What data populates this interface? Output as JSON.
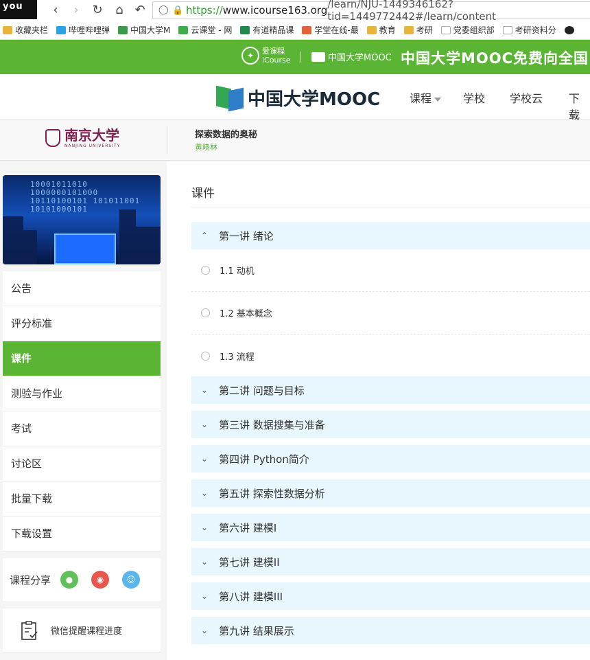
{
  "browser": {
    "tab_thumb_text": "you",
    "url_scheme": "https://",
    "url_host": "www.icourse163.org",
    "url_path": "/learn/NJU-1449346162?tid=1449772442#/learn/content",
    "bookmarks": [
      "收藏夹栏",
      "哔哩哔哩弹",
      "中国大学M",
      "云课堂 - 网",
      "有道精品课",
      "学堂在线-最",
      "教育",
      "考研",
      "党委组织部",
      "考研资料分"
    ]
  },
  "banner": {
    "icourse_cn": "爱课程",
    "icourse_en": "iCourse",
    "mooc_small": "中国大学MOOC",
    "title": "中国大学MOOC免费向全国"
  },
  "header": {
    "logo_text": "中国大学MOOC",
    "nav": [
      "课程",
      "学校",
      "学校云",
      "下载"
    ]
  },
  "course": {
    "university_cn": "南京大学",
    "university_en": "NANJING UNIVERSITY",
    "title": "探索数据的奥秘",
    "teacher": "黄晓林"
  },
  "sidebar": {
    "image_binary": "10001011010 1000000101000 10110100101 101011001 10101000101",
    "menu": [
      "公告",
      "评分标准",
      "课件",
      "测验与作业",
      "考试",
      "讨论区",
      "批量下载",
      "下载设置"
    ],
    "active_index": 2,
    "share_label": "课程分享",
    "share_icons": [
      "wechat-icon",
      "weibo-icon",
      "qq-icon"
    ],
    "remind_label": "微信提醒课程进度"
  },
  "main": {
    "title": "课件",
    "chapters": [
      {
        "title": "第一讲 绪论",
        "expanded": true,
        "lessons": [
          "1.1 动机",
          "1.2 基本概念",
          "1.3 流程"
        ]
      },
      {
        "title": "第二讲 问题与目标",
        "expanded": false
      },
      {
        "title": "第三讲 数据搜集与准备",
        "expanded": false
      },
      {
        "title": "第四讲 Python简介",
        "expanded": false
      },
      {
        "title": "第五讲 探索性数据分析",
        "expanded": false
      },
      {
        "title": "第六讲 建模I",
        "expanded": false
      },
      {
        "title": "第七讲 建模II",
        "expanded": false
      },
      {
        "title": "第八讲 建模III",
        "expanded": false
      },
      {
        "title": "第九讲 结果展示",
        "expanded": false
      }
    ]
  },
  "colors": {
    "brand_green": "#5bb535",
    "chapter_bg": "#e8f7fe"
  }
}
